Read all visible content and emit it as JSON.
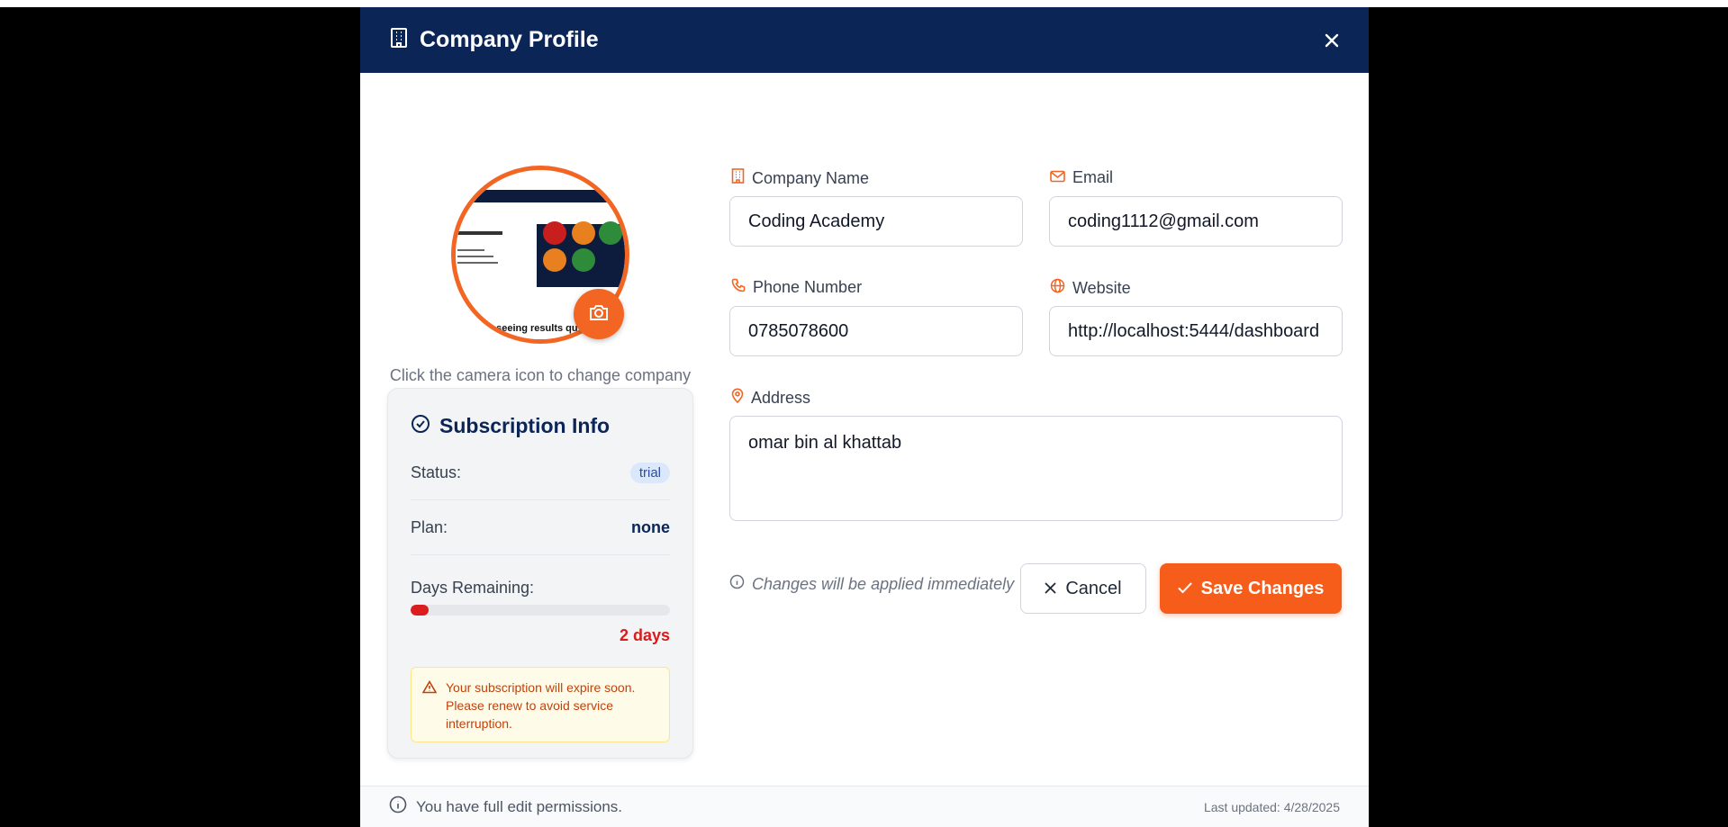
{
  "modal": {
    "title": "Company Profile"
  },
  "logo": {
    "hint": "Click the camera icon to change company logo",
    "preview_text": "art seeing results qu"
  },
  "subscription": {
    "title": "Subscription Info",
    "status_label": "Status:",
    "status_value": "trial",
    "plan_label": "Plan:",
    "plan_value": "none",
    "days_label": "Days Remaining:",
    "days_value": "2 days",
    "days_progress_fraction": 0.07,
    "warning": "Your subscription will expire soon. Please renew to avoid service interruption."
  },
  "form": {
    "company_name_label": "Company Name",
    "company_name_value": "Coding Academy",
    "email_label": "Email",
    "email_value": "coding1112@gmail.com",
    "phone_label": "Phone Number",
    "phone_value": "0785078600",
    "website_label": "Website",
    "website_value": "http://localhost:5444/dashboard",
    "address_label": "Address",
    "address_value": "omar bin al khattab",
    "note": "Changes will be applied immediately",
    "cancel_label": "Cancel",
    "save_label": "Save Changes"
  },
  "footer": {
    "permissions": "You have full edit permissions.",
    "last_updated": "Last updated: 4/28/2025"
  },
  "colors": {
    "header_bg": "#0b2557",
    "accent": "#f65d1b",
    "danger": "#dc1d1d"
  }
}
